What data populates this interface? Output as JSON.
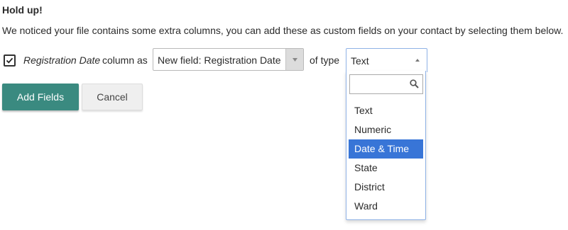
{
  "heading": "Hold up!",
  "notice": "We noticed your file contains some extra columns, you can add these as custom fields on your contact by selecting them below.",
  "mapping": {
    "checked": true,
    "column_name": "Registration Date",
    "column_as": "column as",
    "field_value": "New field: Registration Date",
    "of_type": "of type",
    "type_value": "Text"
  },
  "type_dropdown": {
    "search_value": "",
    "options": [
      {
        "label": "Text",
        "selected": false
      },
      {
        "label": "Numeric",
        "selected": false
      },
      {
        "label": "Date & Time",
        "selected": true
      },
      {
        "label": "State",
        "selected": false
      },
      {
        "label": "District",
        "selected": false
      },
      {
        "label": "Ward",
        "selected": false
      }
    ]
  },
  "buttons": {
    "add_label": "Add Fields",
    "cancel_label": "Cancel"
  },
  "colors": {
    "primary_button": "#3a8a80",
    "highlight": "#3875d7",
    "focus_border": "#8fb2e6"
  },
  "icons": {
    "checkbox": "checkmark-icon",
    "field_select_arrow": "triangle-down-icon",
    "type_select_arrow": "triangle-up-icon",
    "search": "magnifier-icon"
  }
}
